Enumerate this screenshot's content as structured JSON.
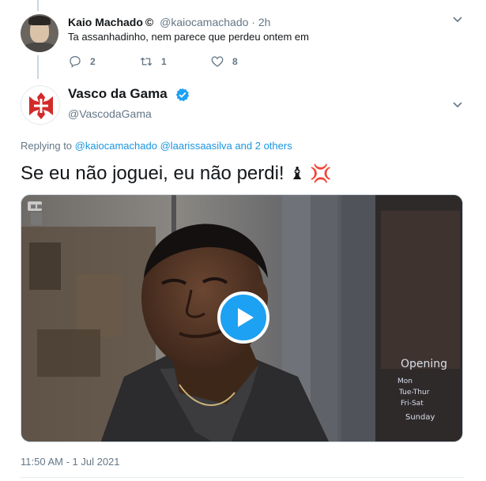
{
  "reply_tweet": {
    "display_name": "Kaio Machado",
    "name_emoji": "©",
    "handle": "@kaiocamachado",
    "separator": "·",
    "time": "2h",
    "text": "Ta assanhadinho, nem parece que perdeu ontem em",
    "actions": {
      "reply_count": "2",
      "retweet_count": "1",
      "like_count": "8"
    }
  },
  "main_tweet": {
    "display_name": "Vasco da Gama",
    "handle": "@VascodaGama",
    "replying_prefix": "Replying to",
    "replying_mentions": [
      "@kaiocamachado",
      "@laarissaasilva"
    ],
    "replying_suffix": "and 2 others",
    "text": "Se eu não joguei, eu não perdi!",
    "text_emojis": "♝ 💢",
    "timestamp": "11:50 AM - 1 Jul 2021",
    "media": {
      "type": "video",
      "overlay_sign_text": [
        "Opening",
        "Mon",
        "Tue-Thur",
        "Fri-Sat",
        "Sunday"
      ]
    }
  },
  "colors": {
    "accent": "#1da1f2",
    "mention": "#1b95e0",
    "muted": "#657786",
    "text": "#14171a",
    "vasco_red": "#d32a2a"
  },
  "icons": {
    "reply": "reply-icon",
    "retweet": "retweet-icon",
    "like": "heart-icon",
    "more": "chevron-down-icon",
    "verified": "verified-badge-icon",
    "play": "play-icon"
  }
}
